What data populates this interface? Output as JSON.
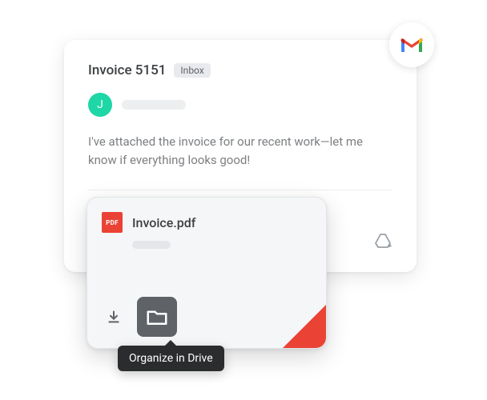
{
  "email": {
    "subject": "Invoice 5151",
    "inbox_label": "Inbox",
    "avatar_initial": "J",
    "body": "I've attached the invoice for our recent work—let me know if everything looks good!"
  },
  "attachment": {
    "pdf_badge": "PDF",
    "filename": "Invoice.pdf"
  },
  "tooltip": {
    "text": "Organize in Drive"
  }
}
